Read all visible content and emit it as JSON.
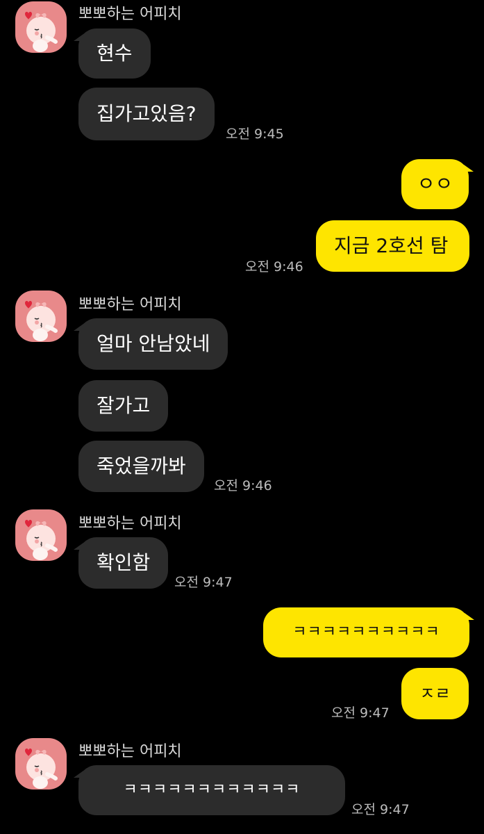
{
  "chat": {
    "groups": [
      {
        "sender": "뽀뽀하는 어피치",
        "messages": [
          "현수",
          "집가고있음?"
        ],
        "time": "오전 9:45"
      },
      {
        "outgoing": [
          "ㅇㅇ",
          "지금 2호선 탐"
        ],
        "time": "오전 9:46"
      },
      {
        "sender": "뽀뽀하는 어피치",
        "messages": [
          "얼마 안남았네",
          "잘가고",
          "죽었을까봐"
        ],
        "time": "오전 9:46"
      },
      {
        "sender": "뽀뽀하는 어피치",
        "messages": [
          "확인함"
        ],
        "time": "오전 9:47"
      },
      {
        "outgoing": [
          "ㅋㅋㅋㅋㅋㅋㅋㅋㅋㅋ",
          "ㅈㄹ"
        ],
        "time": "오전 9:47"
      },
      {
        "sender": "뽀뽀하는 어피치",
        "messages": [
          "ㅋㅋㅋㅋㅋㅋㅋㅋㅋㅋㅋㅋ"
        ],
        "time": "오전 9:47"
      }
    ]
  },
  "colors": {
    "background": "#000000",
    "incoming_bubble": "#2c2c2c",
    "outgoing_bubble": "#fee500",
    "avatar_bg": "#e8898a"
  },
  "icons": {
    "avatar": "apeach-kiss-profile-icon"
  }
}
